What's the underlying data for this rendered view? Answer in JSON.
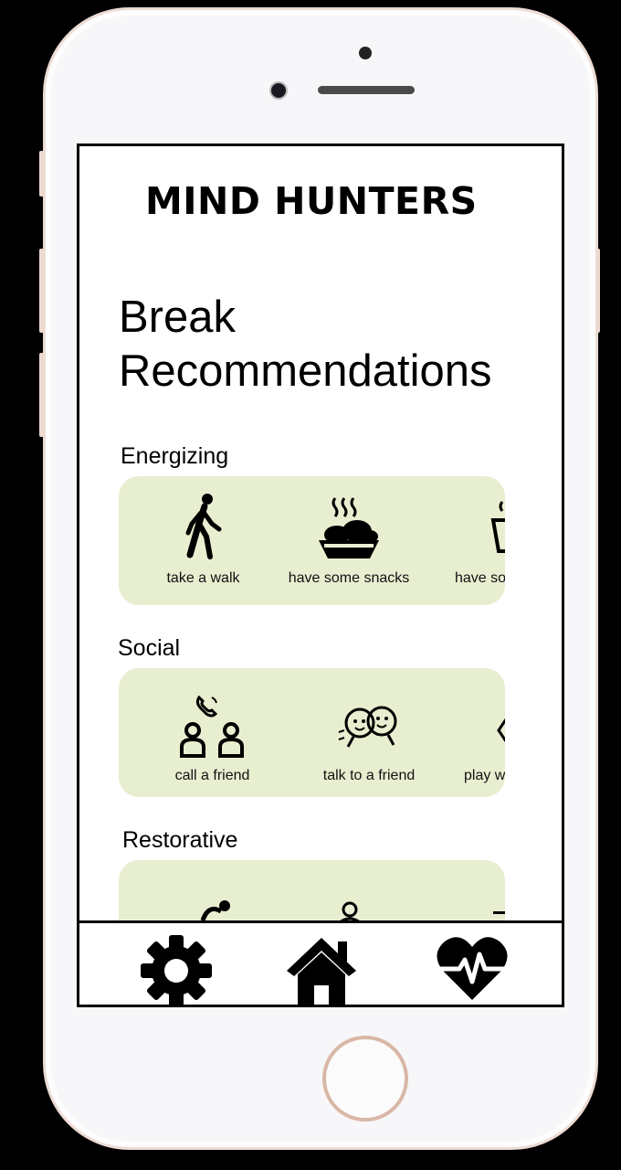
{
  "app": {
    "brand": "MIND HUNTERS",
    "title": "Break Recommendations"
  },
  "sections": [
    {
      "label": "Energizing",
      "items": [
        {
          "label": "take a walk",
          "icon": "walking-person-icon"
        },
        {
          "label": "have some snacks",
          "icon": "snack-bowl-icon"
        },
        {
          "label": "have so",
          "icon": "tea-cup-icon"
        }
      ]
    },
    {
      "label": "Social",
      "items": [
        {
          "label": "call a friend",
          "icon": "phone-call-people-icon"
        },
        {
          "label": "talk to a friend",
          "icon": "talking-friends-icon"
        },
        {
          "label": "play w",
          "icon": "play-figure-icon"
        }
      ]
    },
    {
      "label": "Restorative",
      "items": [
        {
          "label": "",
          "icon": "stretching-person-icon"
        },
        {
          "label": "",
          "icon": "meditation-person-icon"
        },
        {
          "label": "",
          "icon": "restorative-icon"
        }
      ]
    }
  ],
  "tabbar": [
    {
      "name": "settings",
      "icon": "gear-icon"
    },
    {
      "name": "home",
      "icon": "home-icon"
    },
    {
      "name": "health",
      "icon": "heartbeat-icon"
    }
  ],
  "colors": {
    "card_bg": "#e8efd0",
    "screen_bg": "#ffffff",
    "text": "#000000"
  }
}
